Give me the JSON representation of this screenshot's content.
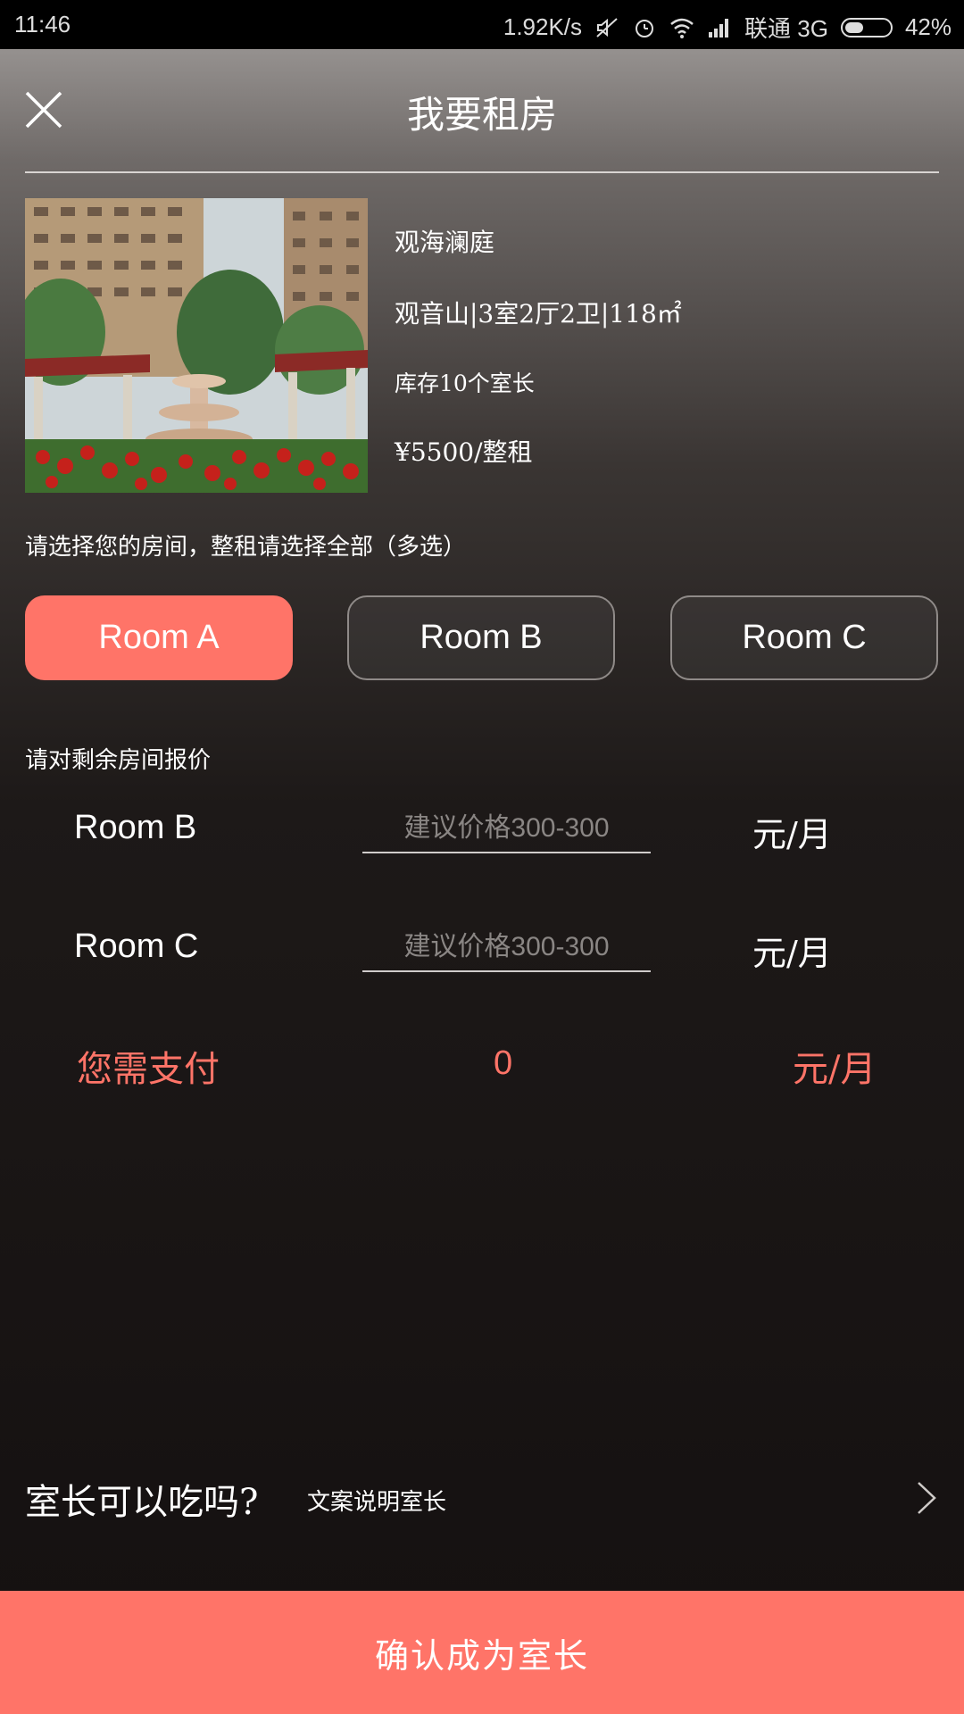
{
  "status_bar": {
    "time": "11:46",
    "net_speed": "1.92K/s",
    "carrier": "联通 3G",
    "battery_percent": "42%",
    "battery_level": 0.42,
    "icons": [
      "mute-icon",
      "alarm-icon",
      "wifi-icon",
      "signal-icon",
      "battery-icon"
    ]
  },
  "header": {
    "title": "我要租房",
    "close_icon": "close-icon"
  },
  "listing": {
    "name": "观海澜庭",
    "details": "观音山|3室2厅2卫|118㎡",
    "inventory": "库存10个室长",
    "price": "¥5500/整租"
  },
  "room_select": {
    "prompt": "请选择您的房间，整租请选择全部（多选）",
    "rooms": [
      {
        "label": "Room A",
        "selected": true
      },
      {
        "label": "Room B",
        "selected": false
      },
      {
        "label": "Room C",
        "selected": false
      }
    ]
  },
  "quote": {
    "prompt": "请对剩余房间报价",
    "rows": [
      {
        "label": "Room B",
        "placeholder": "建议价格300-300",
        "unit": "元/月"
      },
      {
        "label": "Room C",
        "placeholder": "建议价格300-300",
        "unit": "元/月"
      }
    ]
  },
  "payment": {
    "label": "您需支付",
    "value": "0",
    "unit": "元/月"
  },
  "question": {
    "title": "室长可以吃吗?",
    "description": "文案说明室长",
    "icon": "chevron-right-icon"
  },
  "confirm": {
    "label": "确认成为室长"
  },
  "colors": {
    "accent": "#ff7468",
    "status_bar_bg": "#000000"
  }
}
